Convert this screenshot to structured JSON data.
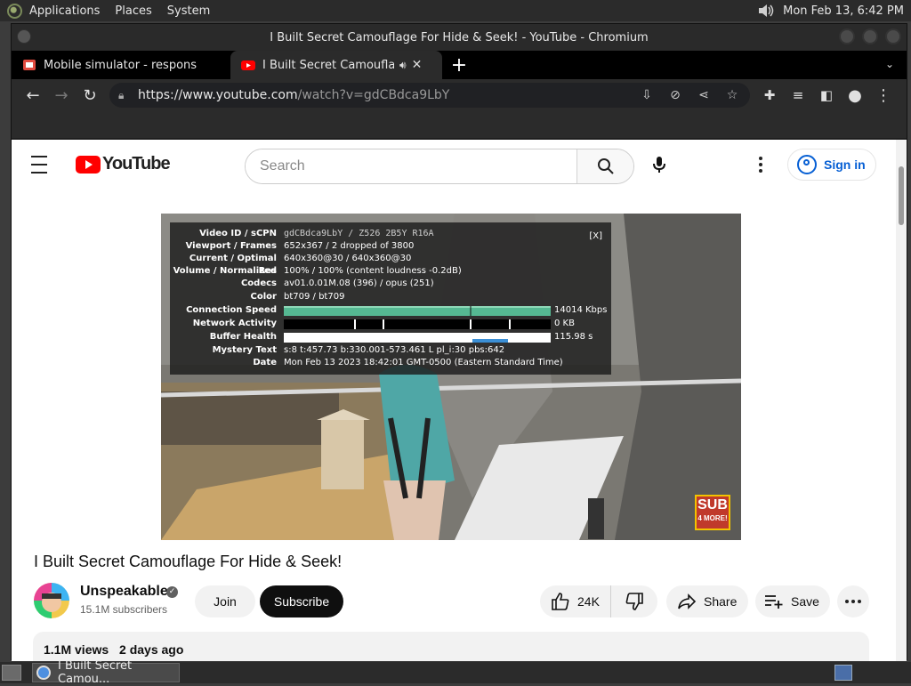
{
  "panel": {
    "menus": [
      "Applications",
      "Places",
      "System"
    ],
    "clock": "Mon Feb 13,  6:42 PM"
  },
  "window": {
    "title": "I Built Secret Camouflage For Hide & Seek! - YouTube - Chromium"
  },
  "tabs": [
    {
      "title": "Mobile simulator - responsive",
      "favicon": "mobile-simulator-favicon",
      "active": false
    },
    {
      "title": "I Built Secret Camouflage For Hide & Seek! - YouTube",
      "favicon": "youtube-favicon",
      "active": true,
      "audio": "speaker-icon"
    }
  ],
  "toolbar": {
    "url_host": "https://www.youtube.com",
    "url_path": "/watch?v=gdCBdca9LbY",
    "omnibox_icons": [
      "install-icon",
      "eye-off-icon",
      "share-icon",
      "star-icon"
    ],
    "right_icons": [
      "extensions-icon",
      "media-icon",
      "sidepanel-icon",
      "profile-icon",
      "menu-icon"
    ]
  },
  "youtube": {
    "logo_text": "YouTube",
    "search_placeholder": "Search",
    "signin_label": "Sign in"
  },
  "stats": {
    "close_label": "[X]",
    "rows": [
      {
        "label": "Video ID / sCPN",
        "value": "gdCBdca9LbY / Z526 2B5Y R16A",
        "mono": true
      },
      {
        "label": "Viewport / Frames",
        "value": "652x367 / 2 dropped of 3800"
      },
      {
        "label": "Current / Optimal Res",
        "value": "640x360@30 / 640x360@30"
      },
      {
        "label": "Volume / Normalized",
        "value": "100% / 100% (content loudness -0.2dB)"
      },
      {
        "label": "Codecs",
        "value": "av01.0.01M.08 (396) / opus (251)"
      },
      {
        "label": "Color",
        "value": "bt709 / bt709"
      }
    ],
    "connection_speed": {
      "label": "Connection Speed",
      "value": "14014 Kbps"
    },
    "network_activity": {
      "label": "Network Activity",
      "value": "0 KB"
    },
    "buffer_health": {
      "label": "Buffer Health",
      "value": "115.98 s"
    },
    "tail_rows": [
      {
        "label": "Mystery Text",
        "value": "s:8 t:457.73 b:330.001-573.461 L pl_i:30 pbs:642"
      },
      {
        "label": "Date",
        "value": "Mon Feb 13 2023 18:42:01 GMT-0500 (Eastern Standard Time)"
      }
    ]
  },
  "sub_badge": {
    "line1": "SUB",
    "line2": "4 MORE!"
  },
  "video": {
    "title": "I Built Secret Camouflage For Hide & Seek!",
    "channel": "Unspeakable",
    "subscribers": "15.1M subscribers",
    "join_label": "Join",
    "subscribe_label": "Subscribe",
    "likes": "24K",
    "share_label": "Share",
    "save_label": "Save",
    "views": "1.1M views",
    "age": "2 days ago"
  },
  "taskbar": {
    "task_title": "I Built Secret Camou..."
  }
}
